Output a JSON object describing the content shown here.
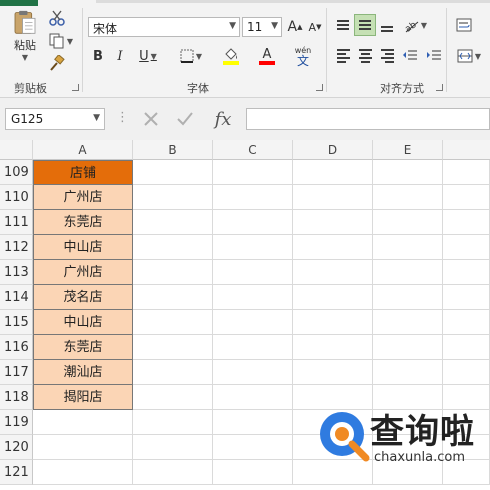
{
  "ribbon": {
    "clipboard": {
      "paste_label": "粘贴",
      "group_label": "剪贴板"
    },
    "font": {
      "font_name": "宋体",
      "font_size": "11",
      "bold": "B",
      "italic": "I",
      "underline": "U",
      "phonetic_top": "wén",
      "phonetic_bottom": "文",
      "group_label": "字体"
    },
    "alignment": {
      "group_label": "对齐方式"
    },
    "colors": {
      "highlight": "#ffff00",
      "font_color": "#ff0000",
      "accent_green": "#217346"
    }
  },
  "formula_bar": {
    "name_box": "G125",
    "fx_label": "fx",
    "formula": ""
  },
  "sheet": {
    "columns": [
      "A",
      "B",
      "C",
      "D",
      "E"
    ],
    "rows": [
      {
        "num": "109",
        "a": "店铺",
        "header": true
      },
      {
        "num": "110",
        "a": "广州店"
      },
      {
        "num": "111",
        "a": "东莞店"
      },
      {
        "num": "112",
        "a": "中山店"
      },
      {
        "num": "113",
        "a": "广州店"
      },
      {
        "num": "114",
        "a": "茂名店"
      },
      {
        "num": "115",
        "a": "中山店"
      },
      {
        "num": "116",
        "a": "东莞店"
      },
      {
        "num": "117",
        "a": "潮汕店"
      },
      {
        "num": "118",
        "a": "揭阳店"
      },
      {
        "num": "119",
        "a": ""
      },
      {
        "num": "120",
        "a": ""
      },
      {
        "num": "121",
        "a": ""
      }
    ],
    "header_fill": "#e46d0a",
    "data_fill": "#fbd5b5"
  },
  "watermark": {
    "title": "查询啦",
    "url": "chaxunla.com"
  }
}
